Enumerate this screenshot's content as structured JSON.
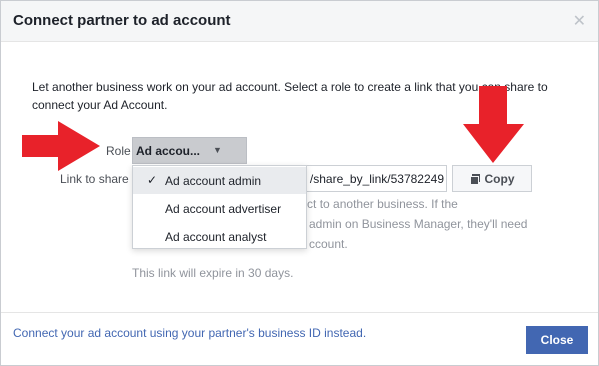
{
  "dialog": {
    "title": "Connect partner to ad account",
    "close_icon": "close-icon",
    "description": "Let another business work on your ad account. Select a role to create a link that you can share to connect your Ad Account.",
    "role_label": "Role",
    "role_selected": "Ad accou...",
    "link_label": "Link to share",
    "link_value": "/share_by_link/53782249",
    "copy_label": "Copy",
    "help_lines": [
      "to connect to another business. If the",
      "admin on Business Manager, they'll need",
      "ccount."
    ],
    "expire_text": "This link will expire in 30 days.",
    "footer_link": "Connect your ad account using your partner's business ID instead.",
    "close_label": "Close"
  },
  "dropdown": {
    "items": [
      {
        "label": "Ad account admin",
        "selected": true
      },
      {
        "label": "Ad account advertiser",
        "selected": false
      },
      {
        "label": "Ad account analyst",
        "selected": false
      }
    ]
  },
  "colors": {
    "accent": "#4267b2",
    "annotation_arrow": "#e8222a",
    "header_bg": "#f5f6f7"
  }
}
